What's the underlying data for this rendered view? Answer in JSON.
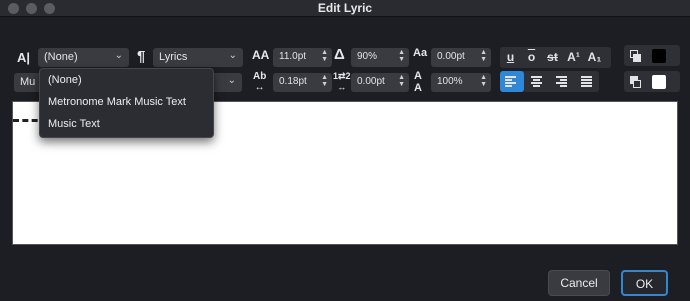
{
  "window": {
    "title": "Edit Lyric"
  },
  "toolbar": {
    "text_style_select": {
      "value": "(None)"
    },
    "paragraph_style_select": {
      "value": "Lyrics"
    },
    "second_row_select": {
      "value": "Mu"
    },
    "font_size": {
      "value": "11.0pt"
    },
    "horizontal_scale": {
      "value": "90%"
    },
    "baseline_shift": {
      "value": "0.00pt"
    },
    "letter_spacing": {
      "value": "0.18pt"
    },
    "line_spacing": {
      "value": "0.00pt"
    },
    "vertical_scale": {
      "value": "100%"
    },
    "format_buttons": [
      "u",
      "o",
      "st",
      "A¹",
      "A₁"
    ]
  },
  "dropdown": {
    "items": [
      {
        "label": "(None)"
      },
      {
        "label": "Metronome Mark Music Text"
      },
      {
        "label": "Music Text"
      }
    ]
  },
  "footer": {
    "cancel_label": "Cancel",
    "ok_label": "OK"
  }
}
